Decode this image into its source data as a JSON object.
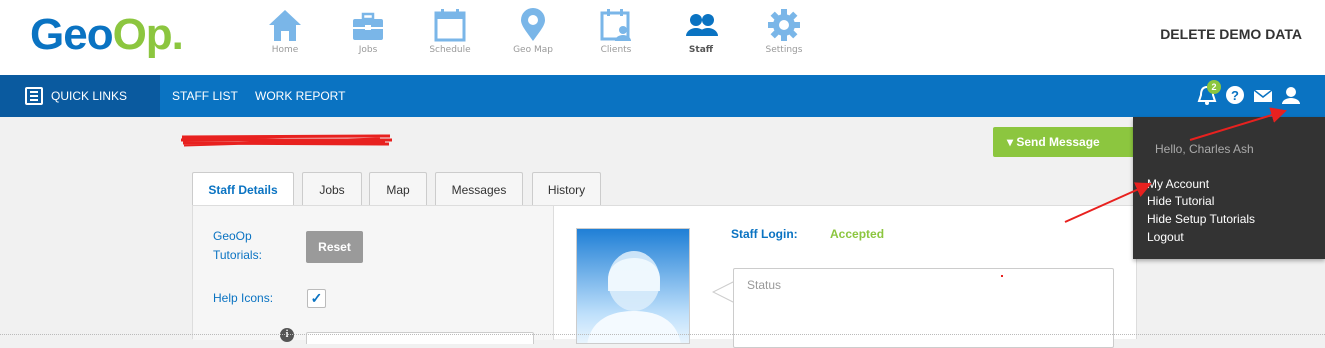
{
  "logo": {
    "part1": "Geo",
    "part2": "Op."
  },
  "nav": [
    {
      "label": "Home",
      "icon": "home-icon"
    },
    {
      "label": "Jobs",
      "icon": "briefcase-icon"
    },
    {
      "label": "Schedule",
      "icon": "calendar-icon"
    },
    {
      "label": "Geo Map",
      "icon": "map-pin-icon"
    },
    {
      "label": "Clients",
      "icon": "clients-icon"
    },
    {
      "label": "Staff",
      "icon": "staff-icon",
      "active": true
    },
    {
      "label": "Settings",
      "icon": "gear-icon"
    }
  ],
  "header": {
    "delete_demo": "DELETE DEMO DATA"
  },
  "bluebar": {
    "quick_links": "QUICK LINKS",
    "staff_list": "STAFF LIST",
    "work_report": "WORK REPORT",
    "notification_count": "2"
  },
  "actions": {
    "send_message": "▾ Send Message"
  },
  "tabs": [
    "Staff Details",
    "Jobs",
    "Map",
    "Messages",
    "History"
  ],
  "staff_details": {
    "tutorials_label_1": "GeoOp",
    "tutorials_label_2": "Tutorials:",
    "reset_label": "Reset",
    "help_icons_label": "Help Icons:",
    "help_icons_checked": true,
    "checkmark": "✓",
    "staff_login_label": "Staff Login:",
    "staff_login_value": "Accepted",
    "status_placeholder": "Status"
  },
  "user_menu": {
    "greeting": "Hello, Charles Ash",
    "items": [
      "My Account",
      "Hide Tutorial",
      "Hide Setup Tutorials",
      "Logout"
    ]
  },
  "colors": {
    "brand_blue": "#0a73c2",
    "brand_green": "#8cc63f",
    "dark_blue": "#0a5a9f",
    "annotation_red": "#e8211f"
  }
}
